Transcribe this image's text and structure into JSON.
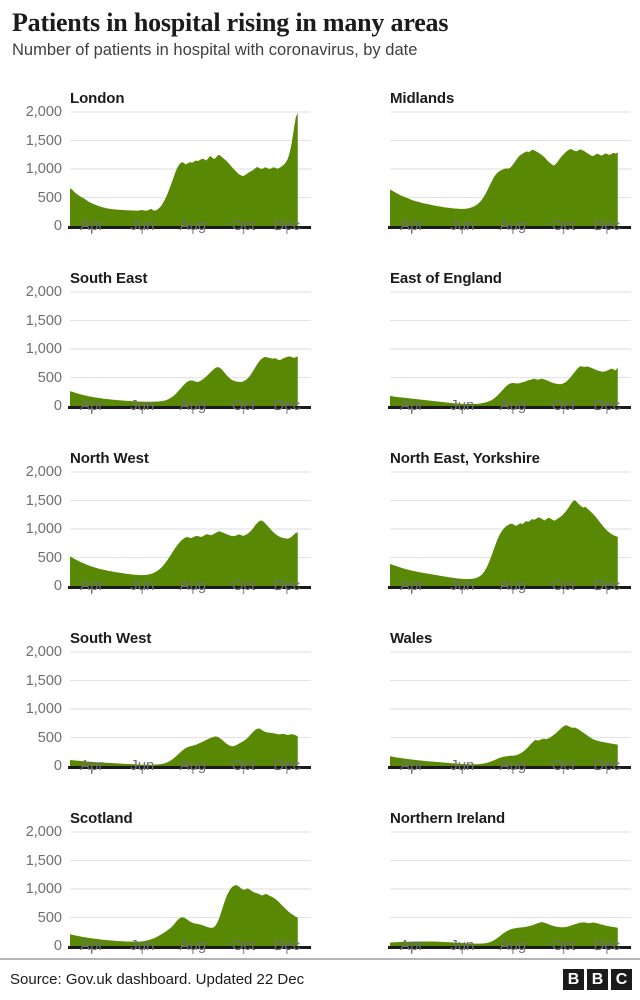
{
  "header": {
    "title": "Patients in hospital rising in many areas",
    "subtitle": "Number of patients in hospital with coronavirus, by date"
  },
  "footer": {
    "source": "Source: Gov.uk dashboard. Updated 22 Dec",
    "logo": [
      "B",
      "B",
      "C"
    ]
  },
  "style": {
    "area_color": "#598804",
    "gridline_color": "#e4e4e6",
    "axis_color": "#1b1b1b",
    "label_color": "#6e6e73"
  },
  "chart_data": {
    "type": "area",
    "title": "Patients in hospital rising in many areas",
    "subtitle": "Number of patients in hospital with coronavirus, by date",
    "xlabel": "",
    "ylabel": "Number of patients in hospital",
    "ylim": [
      0,
      2000
    ],
    "yticks": [
      0,
      500,
      1000,
      1500,
      2000
    ],
    "ytick_labels": [
      "0",
      "500",
      "1,000",
      "1,500",
      "2,000"
    ],
    "grid": true,
    "legend": "none",
    "x_range": [
      "Mar",
      "Dec"
    ],
    "xticks": [
      "Apr",
      "Jun",
      "Aug",
      "Oct",
      "Dec"
    ],
    "xtick_positions": [
      0.09,
      0.3,
      0.51,
      0.72,
      0.9
    ],
    "panel_layout": {
      "rows": 5,
      "cols": 2
    },
    "panels": [
      {
        "name": "London",
        "show_y_axis": true,
        "values": [
          660,
          640,
          600,
          570,
          545,
          520,
          500,
          480,
          455,
          430,
          410,
          395,
          380,
          365,
          350,
          340,
          330,
          320,
          312,
          305,
          300,
          295,
          292,
          288,
          285,
          282,
          280,
          278,
          276,
          275,
          274,
          272,
          270,
          268,
          272,
          280,
          276,
          268,
          272,
          285,
          300,
          275,
          270,
          290,
          320,
          360,
          420,
          490,
          570,
          660,
          760,
          860,
          960,
          1040,
          1090,
          1120,
          1105,
          1080,
          1100,
          1120,
          1110,
          1130,
          1150,
          1140,
          1160,
          1180,
          1170,
          1150,
          1190,
          1230,
          1195,
          1175,
          1210,
          1250,
          1235,
          1200,
          1170,
          1140,
          1100,
          1060,
          1020,
          980,
          945,
          910,
          890,
          875,
          890,
          915,
          940,
          960,
          980,
          1010,
          1035,
          1020,
          1000,
          1010,
          1030,
          1015,
          1000,
          1010,
          1030,
          1020,
          1005,
          1020,
          1045,
          1070,
          1110,
          1170,
          1280,
          1450,
          1680,
          1900,
          1990
        ]
      },
      {
        "name": "Midlands",
        "show_y_axis": false,
        "values": [
          640,
          620,
          600,
          580,
          560,
          540,
          525,
          510,
          495,
          480,
          465,
          450,
          440,
          430,
          420,
          410,
          400,
          392,
          385,
          378,
          370,
          362,
          355,
          348,
          342,
          336,
          330,
          325,
          320,
          316,
          312,
          308,
          305,
          302,
          300,
          298,
          300,
          305,
          312,
          322,
          335,
          352,
          375,
          405,
          445,
          495,
          555,
          625,
          700,
          775,
          845,
          900,
          940,
          965,
          985,
          1000,
          1010,
          1005,
          1020,
          1060,
          1110,
          1160,
          1210,
          1245,
          1270,
          1290,
          1310,
          1295,
          1320,
          1340,
          1320,
          1300,
          1280,
          1255,
          1225,
          1190,
          1150,
          1115,
          1085,
          1060,
          1085,
          1130,
          1180,
          1225,
          1265,
          1300,
          1330,
          1350,
          1340,
          1320,
          1310,
          1330,
          1345,
          1330,
          1310,
          1285,
          1260,
          1240,
          1225,
          1245,
          1270,
          1255,
          1235,
          1250,
          1275,
          1260,
          1245,
          1265,
          1285,
          1270,
          1290
        ]
      },
      {
        "name": "South East",
        "show_y_axis": true,
        "values": [
          260,
          250,
          238,
          225,
          215,
          205,
          196,
          188,
          180,
          172,
          165,
          158,
          152,
          146,
          140,
          135,
          130,
          126,
          122,
          118,
          114,
          110,
          107,
          104,
          101,
          98,
          95,
          92,
          90,
          88,
          86,
          84,
          82,
          80,
          78,
          77,
          76,
          75,
          74,
          74,
          75,
          76,
          78,
          80,
          83,
          88,
          95,
          105,
          120,
          140,
          165,
          195,
          230,
          270,
          310,
          350,
          390,
          420,
          440,
          450,
          445,
          430,
          420,
          430,
          450,
          475,
          505,
          540,
          575,
          610,
          645,
          670,
          685,
          670,
          640,
          600,
          555,
          515,
          480,
          455,
          440,
          430,
          425,
          420,
          425,
          440,
          465,
          500,
          545,
          600,
          660,
          720,
          775,
          815,
          845,
          860,
          855,
          845,
          835,
          830,
          840,
          820,
          805,
          815,
          835,
          850,
          865,
          870,
          860,
          845,
          855,
          870
        ]
      },
      {
        "name": "East of England",
        "show_y_axis": false,
        "values": [
          175,
          170,
          165,
          160,
          156,
          152,
          148,
          144,
          140,
          136,
          132,
          128,
          124,
          120,
          116,
          112,
          108,
          104,
          100,
          96,
          92,
          88,
          84,
          80,
          76,
          72,
          68,
          64,
          60,
          56,
          52,
          48,
          45,
          42,
          40,
          38,
          36,
          35,
          34,
          34,
          35,
          36,
          38,
          40,
          44,
          50,
          58,
          68,
          80,
          95,
          115,
          140,
          170,
          205,
          245,
          285,
          325,
          360,
          385,
          400,
          405,
          400,
          395,
          400,
          410,
          420,
          430,
          445,
          455,
          465,
          480,
          470,
          460,
          470,
          480,
          470,
          455,
          440,
          425,
          410,
          398,
          390,
          385,
          382,
          390,
          405,
          430,
          465,
          505,
          550,
          595,
          640,
          680,
          700,
          690,
          685,
          695,
          685,
          670,
          655,
          640,
          625,
          615,
          605,
          600,
          610,
          625,
          640,
          655,
          640,
          625,
          680
        ]
      },
      {
        "name": "North West",
        "show_y_axis": true,
        "values": [
          520,
          500,
          480,
          460,
          442,
          425,
          410,
          395,
          380,
          366,
          352,
          340,
          328,
          318,
          308,
          298,
          290,
          282,
          275,
          268,
          262,
          255,
          248,
          242,
          236,
          230,
          225,
          220,
          215,
          210,
          206,
          202,
          198,
          195,
          192,
          190,
          190,
          192,
          196,
          202,
          210,
          222,
          238,
          258,
          282,
          312,
          348,
          390,
          438,
          490,
          545,
          600,
          655,
          705,
          750,
          790,
          820,
          845,
          860,
          850,
          840,
          855,
          870,
          880,
          870,
          860,
          875,
          895,
          910,
          900,
          890,
          905,
          925,
          945,
          960,
          950,
          935,
          920,
          905,
          890,
          880,
          875,
          880,
          895,
          905,
          890,
          880,
          895,
          915,
          940,
          975,
          1020,
          1070,
          1110,
          1140,
          1150,
          1130,
          1095,
          1055,
          1015,
          975,
          940,
          910,
          885,
          865,
          850,
          840,
          835,
          830,
          840,
          865,
          900,
          930,
          945
        ]
      },
      {
        "name": "North East, Yorkshire",
        "show_y_axis": false,
        "values": [
          385,
          375,
          362,
          350,
          338,
          326,
          315,
          305,
          295,
          286,
          277,
          268,
          260,
          252,
          245,
          238,
          232,
          226,
          220,
          214,
          208,
          202,
          196,
          190,
          184,
          178,
          172,
          166,
          160,
          154,
          148,
          143,
          138,
          134,
          130,
          127,
          124,
          122,
          121,
          122,
          125,
          130,
          138,
          150,
          168,
          195,
          235,
          290,
          360,
          445,
          540,
          640,
          740,
          830,
          905,
          965,
          1010,
          1045,
          1070,
          1085,
          1095,
          1075,
          1055,
          1075,
          1100,
          1085,
          1110,
          1140,
          1125,
          1150,
          1175,
          1160,
          1185,
          1205,
          1190,
          1170,
          1150,
          1175,
          1200,
          1180,
          1160,
          1145,
          1170,
          1195,
          1220,
          1250,
          1290,
          1335,
          1385,
          1440,
          1490,
          1505,
          1470,
          1430,
          1400,
          1375,
          1390,
          1360,
          1330,
          1295,
          1260,
          1220,
          1175,
          1130,
          1085,
          1040,
          1000,
          965,
          935,
          910,
          890,
          875,
          865
        ]
      },
      {
        "name": "South West",
        "show_y_axis": true,
        "values": [
          105,
          102,
          98,
          95,
          92,
          89,
          86,
          83,
          80,
          77,
          74,
          71,
          69,
          66,
          64,
          62,
          60,
          58,
          56,
          54,
          52,
          50,
          48,
          46,
          44,
          42,
          40,
          38,
          36,
          34,
          32,
          30,
          28,
          26,
          25,
          24,
          23,
          22,
          22,
          22,
          23,
          24,
          26,
          28,
          32,
          38,
          46,
          58,
          75,
          95,
          120,
          150,
          182,
          215,
          248,
          278,
          305,
          325,
          340,
          350,
          358,
          368,
          382,
          398,
          415,
          432,
          450,
          468,
          485,
          500,
          512,
          520,
          510,
          490,
          462,
          430,
          400,
          375,
          355,
          345,
          350,
          365,
          385,
          405,
          425,
          448,
          475,
          510,
          550,
          590,
          625,
          650,
          660,
          645,
          620,
          600,
          590,
          585,
          580,
          575,
          570,
          560,
          555,
          560,
          565,
          555,
          545,
          550,
          560,
          550,
          540,
          520
        ]
      },
      {
        "name": "Wales",
        "show_y_axis": false,
        "values": [
          170,
          164,
          158,
          152,
          146,
          140,
          135,
          130,
          125,
          120,
          116,
          112,
          108,
          104,
          100,
          96,
          92,
          88,
          85,
          82,
          79,
          76,
          73,
          70,
          67,
          64,
          61,
          58,
          55,
          52,
          49,
          46,
          43,
          40,
          37,
          35,
          33,
          31,
          30,
          29,
          29,
          30,
          31,
          33,
          36,
          40,
          46,
          54,
          64,
          76,
          90,
          105,
          120,
          135,
          148,
          158,
          166,
          172,
          178,
          182,
          180,
          186,
          195,
          210,
          230,
          255,
          285,
          320,
          360,
          400,
          435,
          460,
          445,
          455,
          470,
          480,
          470,
          480,
          500,
          525,
          550,
          580,
          615,
          650,
          680,
          705,
          715,
          700,
          680,
          670,
          675,
          660,
          640,
          615,
          590,
          565,
          540,
          515,
          490,
          470,
          455,
          445,
          435,
          425,
          418,
          412,
          405,
          398,
          392,
          386,
          380,
          375
        ]
      },
      {
        "name": "Scotland",
        "show_y_axis": true,
        "values": [
          205,
          198,
          190,
          182,
          175,
          168,
          162,
          156,
          150,
          144,
          139,
          134,
          129,
          124,
          120,
          116,
          112,
          108,
          105,
          102,
          99,
          96,
          93,
          90,
          88,
          86,
          84,
          82,
          80,
          79,
          78,
          77,
          76,
          76,
          77,
          79,
          82,
          86,
          92,
          100,
          110,
          122,
          136,
          152,
          170,
          190,
          210,
          232,
          255,
          280,
          308,
          340,
          378,
          420,
          460,
          490,
          505,
          500,
          480,
          455,
          430,
          412,
          400,
          392,
          386,
          378,
          368,
          355,
          342,
          330,
          322,
          318,
          330,
          365,
          430,
          520,
          630,
          740,
          840,
          920,
          985,
          1030,
          1055,
          1070,
          1055,
          1030,
          1000,
          985,
          995,
          1010,
          990,
          965,
          945,
          930,
          920,
          905,
          885,
          900,
          915,
          900,
          880,
          865,
          845,
          820,
          790,
          755,
          720,
          685,
          650,
          615,
          585,
          560,
          540,
          510,
          500
        ]
      },
      {
        "name": "Northern Ireland",
        "show_y_axis": false,
        "values": [
          60,
          62,
          64,
          66,
          68,
          70,
          72,
          73,
          74,
          75,
          76,
          77,
          78,
          78,
          79,
          79,
          80,
          80,
          80,
          80,
          79,
          78,
          77,
          76,
          75,
          73,
          71,
          69,
          67,
          65,
          63,
          61,
          59,
          57,
          55,
          53,
          51,
          49,
          47,
          45,
          43,
          42,
          41,
          41,
          42,
          44,
          47,
          52,
          60,
          72,
          88,
          108,
          132,
          158,
          186,
          214,
          240,
          262,
          280,
          295,
          305,
          312,
          318,
          322,
          326,
          330,
          335,
          342,
          350,
          360,
          372,
          386,
          400,
          412,
          418,
          412,
          400,
          385,
          370,
          358,
          348,
          340,
          334,
          330,
          328,
          330,
          336,
          345,
          356,
          368,
          380,
          392,
          402,
          410,
          415,
          412,
          405,
          400,
          405,
          412,
          408,
          398,
          388,
          378,
          368,
          358,
          350,
          344,
          338,
          332,
          326,
          320
        ]
      }
    ]
  }
}
